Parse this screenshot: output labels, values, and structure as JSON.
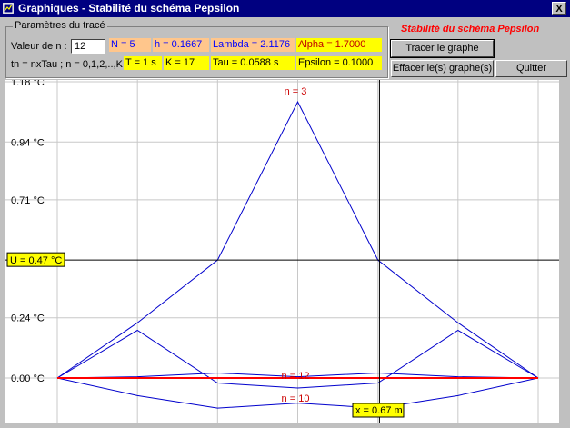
{
  "window": {
    "title": "Graphiques - Stabilité du schéma Pepsilon",
    "close_label": "X"
  },
  "params": {
    "group_title": "Paramètres du tracé",
    "valeur_label": "Valeur de n :",
    "n_value": "12",
    "tn_label": "tn = nxTau ; n = 0,1,2,..,K",
    "N": "N = 5",
    "h": "h = 0.1667",
    "lambda": "Lambda = 2.1176",
    "alpha": "Alpha = 1.7000",
    "T": "T = 1 s",
    "K": "K = 17",
    "tau": "Tau = 0.0588 s",
    "epsilon": "Epsilon = 0.1000"
  },
  "stab_title": "Stabilité du schéma Pepsilon",
  "buttons": {
    "tracer": "Tracer le graphe",
    "effacer": "Effacer le(s) graphe(s)",
    "quitter": "Quitter"
  },
  "plot": {
    "y_ticks": [
      "1.18 °C",
      "0.94 °C",
      "0.71 °C",
      "0.24 °C",
      "0.00 °C"
    ],
    "cursor_u": "U = 0.47 °C",
    "cursor_x": "x = 0.67 m",
    "curve_labels": [
      "n = 3",
      "n = 12",
      "n = 10"
    ],
    "colors": {
      "curve": "#0000cc",
      "highlight": "#ff0000",
      "cursor": "#000000",
      "grid": "#c8c8c8"
    }
  },
  "chart_data": {
    "type": "line",
    "x": [
      0,
      0.1667,
      0.3333,
      0.5,
      0.6667,
      0.8333,
      1.0
    ],
    "ylim": [
      -0.09,
      1.18
    ],
    "series": [
      {
        "name": "n = 3",
        "values": [
          0,
          0.22,
          0.47,
          1.1,
          0.47,
          0.22,
          0
        ]
      },
      {
        "values": [
          0,
          0.19,
          -0.02,
          -0.04,
          -0.02,
          0.19,
          0
        ]
      },
      {
        "values": [
          0,
          0.005,
          0.02,
          0.005,
          0.02,
          0.005,
          0
        ]
      },
      {
        "name": "n = 10",
        "values": [
          0,
          -0.07,
          -0.12,
          -0.1,
          -0.12,
          -0.07,
          0
        ]
      },
      {
        "name": "n = 12",
        "values": [
          0,
          0,
          0,
          0,
          0,
          0,
          0
        ]
      }
    ],
    "cursor": {
      "u": 0.47,
      "x": 0.67
    }
  }
}
